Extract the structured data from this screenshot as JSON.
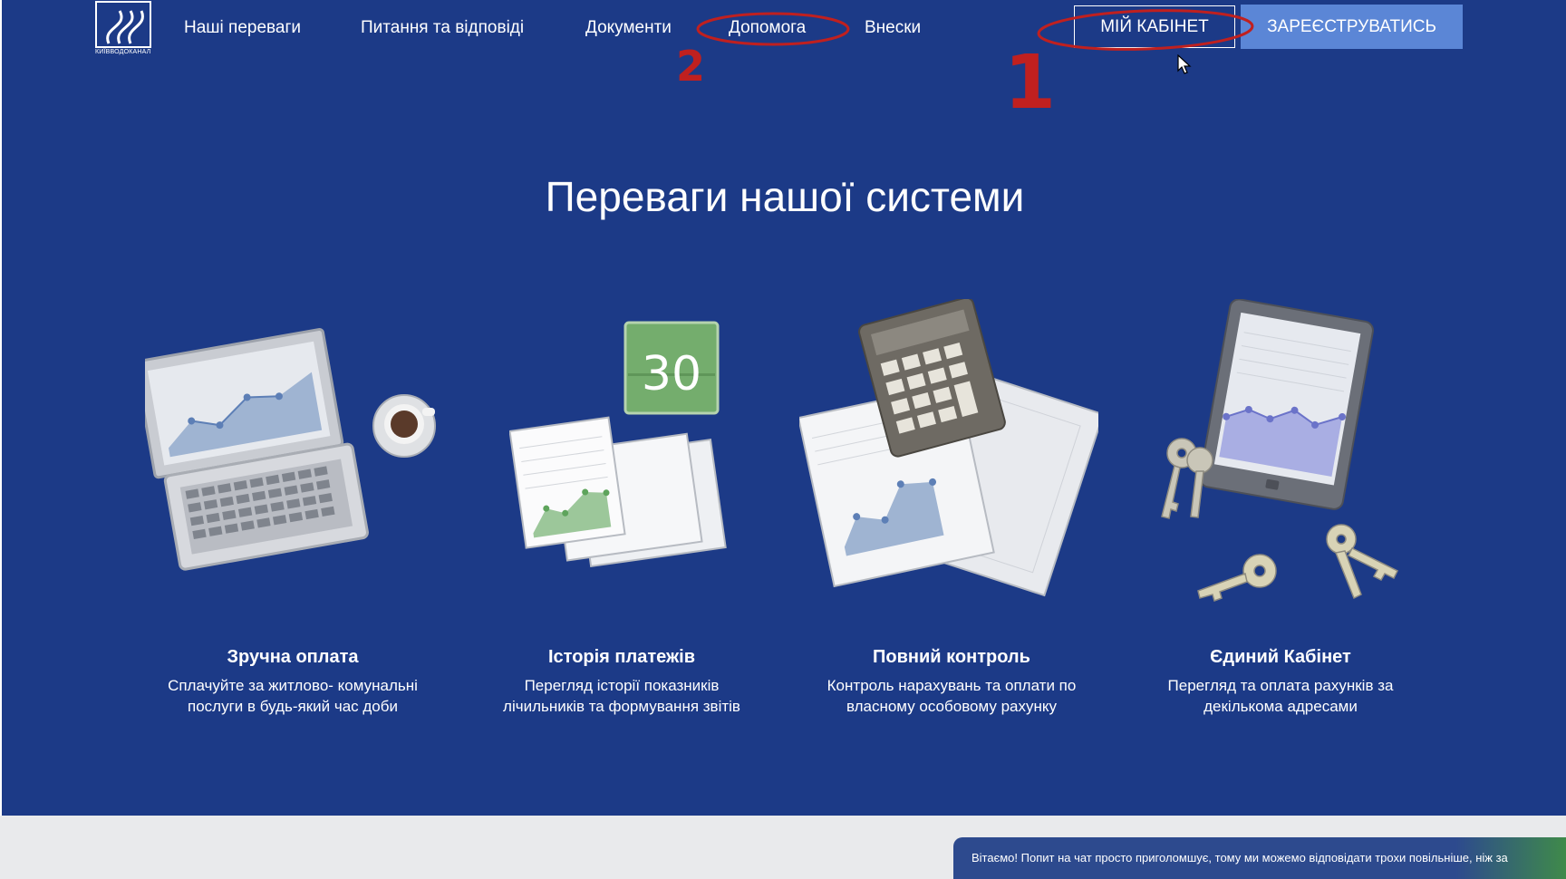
{
  "header": {
    "logo_caption": "КИЇВВОДОКАНАЛ",
    "nav": [
      {
        "label": "Наші переваги"
      },
      {
        "label": "Питання та відповіді"
      },
      {
        "label": "Документи"
      },
      {
        "label": "Допомога"
      },
      {
        "label": "Внески"
      }
    ],
    "cabinet_button": "МІЙ КАБІНЕТ",
    "register_button": "ЗАРЕЄСТРУВАТИСЬ"
  },
  "annotations": {
    "mark_1": "1",
    "mark_2": "2",
    "color": "#c0201f"
  },
  "main": {
    "title": "Переваги нашої системи",
    "features": [
      {
        "title": "Зручна оплата",
        "line1": "Сплачуйте за житлово- комунальні",
        "line2": "послуги в будь-який час доби"
      },
      {
        "title": "Історія платежів",
        "line1": "Перегляд історії показників",
        "line2": "лічильників та формування звітів"
      },
      {
        "title": "Повний контроль",
        "line1": "Контроль нарахувань та оплати по",
        "line2": "власному особовому рахунку"
      },
      {
        "title": "Єдиний Кабінет",
        "line1": "Перегляд та оплата рахунків за",
        "line2": "декількома адресами"
      }
    ],
    "calendar_day": "30"
  },
  "chat": {
    "text": "Вітаємо! Попит на чат просто приголомшує, тому ми можемо відповідати трохи повільніше, ніж за"
  },
  "colors": {
    "background": "#1c3a87",
    "register_button": "#5b86d6",
    "footer": "#e9eaec"
  }
}
